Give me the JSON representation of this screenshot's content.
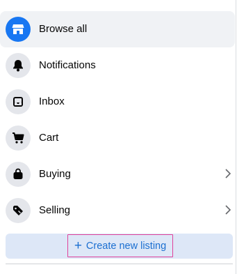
{
  "colors": {
    "active_icon_bg": "#1877f2",
    "icon_bg": "#e4e6eb",
    "create_button_bg": "#dde7f7",
    "create_button_text": "#1b6fd1",
    "highlight_border": "#e0429b"
  },
  "menu": {
    "items": [
      {
        "label": "Browse all",
        "icon": "storefront-icon",
        "active": true
      },
      {
        "label": "Notifications",
        "icon": "bell-icon"
      },
      {
        "label": "Inbox",
        "icon": "inbox-icon"
      },
      {
        "label": "Cart",
        "icon": "cart-icon"
      },
      {
        "label": "Buying",
        "icon": "shopping-bag-icon",
        "chevron": "chevron-right-icon"
      },
      {
        "label": "Selling",
        "icon": "price-tag-icon",
        "chevron": "chevron-right-icon"
      }
    ]
  },
  "create_listing": {
    "icon": "plus-icon",
    "label": "Create new listing"
  }
}
